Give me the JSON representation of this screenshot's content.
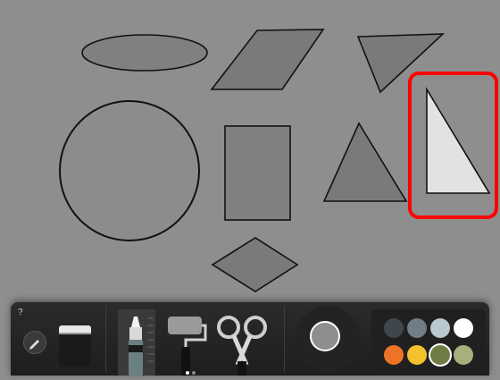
{
  "toolbar": {
    "help_label": "?",
    "current_color": "#8e8e8e",
    "palette": [
      {
        "name": "dark-slate",
        "color": "#3f474d"
      },
      {
        "name": "steel-grey",
        "color": "#727c84"
      },
      {
        "name": "pale-blue",
        "color": "#b9c8d0"
      },
      {
        "name": "white",
        "color": "#ffffff"
      },
      {
        "name": "orange",
        "color": "#ee7326"
      },
      {
        "name": "yellow",
        "color": "#f3c12b"
      },
      {
        "name": "olive",
        "color": "#6f7c43"
      },
      {
        "name": "sage",
        "color": "#a5b07c"
      }
    ],
    "selected_swatch": "olive",
    "page_indicator": {
      "pages": 2,
      "active": 1
    }
  },
  "canvas": {
    "highlighted_shape": "right-triangle",
    "highlight_color": "#ff0000"
  }
}
